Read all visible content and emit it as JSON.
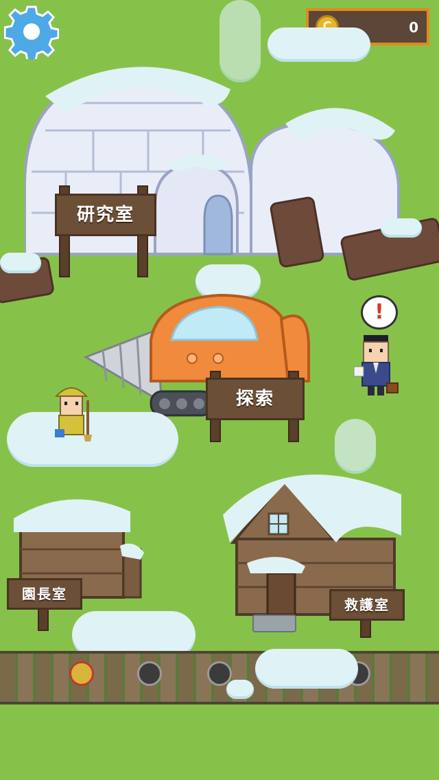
{
  "hud": {
    "settings_icon": "gear-icon",
    "coin_icon": "coin-icon",
    "coin_symbol": "C",
    "coin_count": "0"
  },
  "buildings": {
    "lab": {
      "label": "研究室"
    },
    "explore": {
      "label": "探索"
    },
    "director": {
      "label": "園長室"
    },
    "rescue": {
      "label": "救護室"
    }
  },
  "npc": {
    "alert_icon": "exclamation-icon",
    "alert_symbol": "!"
  },
  "progress": {
    "nodes": [
      "active",
      "locked",
      "locked",
      "locked",
      "locked"
    ]
  },
  "colors": {
    "grass": "#86c24a",
    "sign_wood": "#6b4f36",
    "coin_gold": "#e8b52a",
    "hud_frame": "#e08a1e",
    "drill_orange": "#f08a3c"
  }
}
